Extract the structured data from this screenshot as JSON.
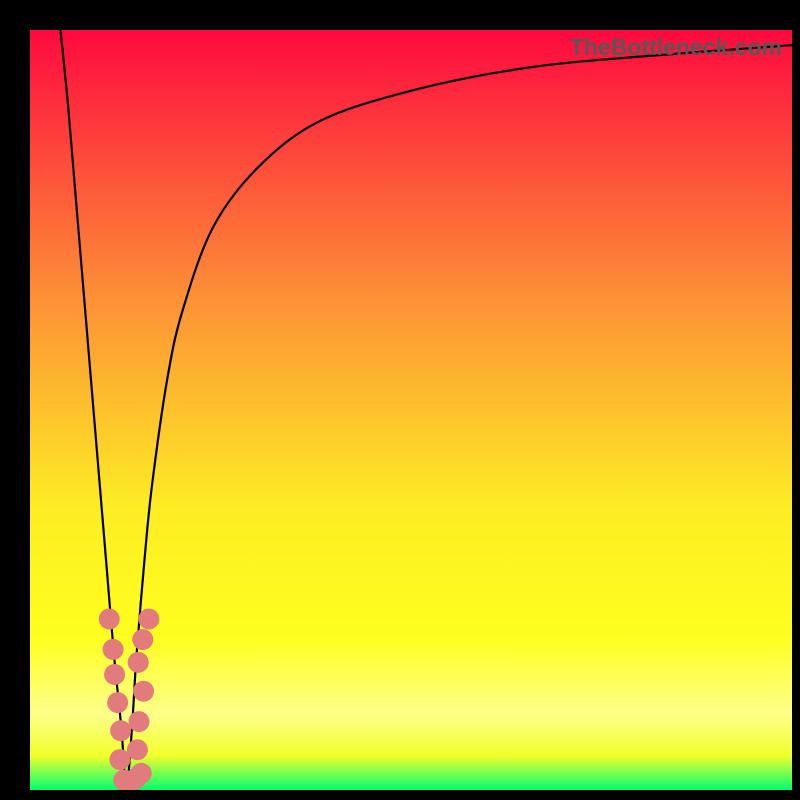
{
  "watermark": "TheBottleneck.com",
  "colors": {
    "gradient_top": "#fe093f",
    "gradient_mid1": "#fd8f36",
    "gradient_mid2": "#fded24",
    "gradient_mid3": "#feff1e",
    "gradient_bottom1": "#f1ff2a",
    "gradient_bottom2": "#00ff6d",
    "curve": "#000000",
    "dot_fill": "#e27b7d",
    "dot_stroke": "#d96a6c",
    "bg": "#000000"
  },
  "chart_data": {
    "type": "line",
    "title": "",
    "xlabel": "",
    "ylabel": "",
    "xlim": [
      0,
      100
    ],
    "ylim": [
      0,
      100
    ],
    "series": [
      {
        "name": "bottleneck-curve",
        "x": [
          4,
          5,
          6,
          7,
          8,
          9,
          10,
          11,
          12,
          12.6,
          13,
          13.5,
          14,
          15,
          16,
          18,
          20,
          24,
          30,
          38,
          50,
          65,
          80,
          100
        ],
        "y": [
          100,
          90,
          78,
          66,
          54,
          42,
          30,
          18,
          8,
          0,
          3,
          10,
          18,
          30,
          40,
          54,
          63,
          74,
          82,
          88,
          92,
          95,
          96.5,
          98
        ]
      }
    ],
    "points": [
      {
        "x": 10.4,
        "y": 22.5
      },
      {
        "x": 10.9,
        "y": 18.5
      },
      {
        "x": 11.1,
        "y": 15.2
      },
      {
        "x": 11.5,
        "y": 11.5
      },
      {
        "x": 11.9,
        "y": 7.8
      },
      {
        "x": 11.8,
        "y": 4.0
      },
      {
        "x": 12.3,
        "y": 1.3
      },
      {
        "x": 13.2,
        "y": 1.2
      },
      {
        "x": 13.9,
        "y": 1.5
      },
      {
        "x": 14.6,
        "y": 2.2
      },
      {
        "x": 14.1,
        "y": 5.3
      },
      {
        "x": 14.3,
        "y": 9.0
      },
      {
        "x": 14.9,
        "y": 13.0
      },
      {
        "x": 14.2,
        "y": 16.8
      },
      {
        "x": 14.8,
        "y": 19.8
      },
      {
        "x": 15.6,
        "y": 22.5
      }
    ]
  }
}
